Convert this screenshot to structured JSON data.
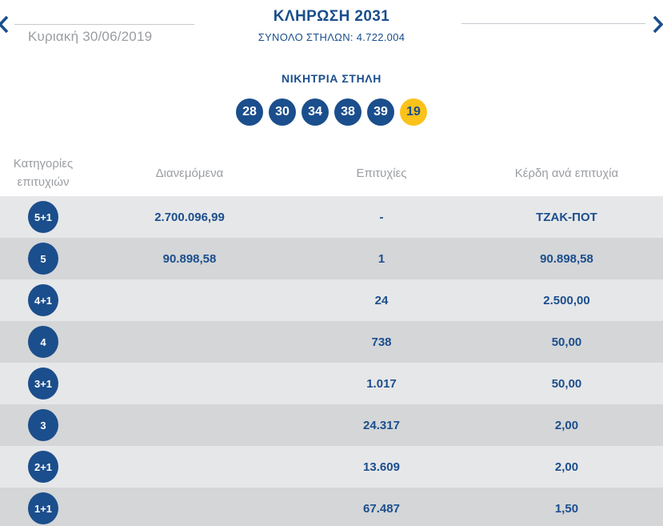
{
  "header": {
    "title": "ΚΛΗΡΩΣΗ 2031",
    "total_label": "ΣΥΝΟΛΟ ΣΤΗΛΩΝ:",
    "total_value": "4.722.004",
    "date": "Κυριακή 30/06/2019"
  },
  "winning": {
    "title": "ΝΙΚΗΤΡΙΑ ΣΤΗΛΗ",
    "numbers": [
      "28",
      "30",
      "34",
      "38",
      "39"
    ],
    "joker": "19"
  },
  "table": {
    "headers": [
      "Κατηγορίες επιτυχιών",
      "Διανεμόμενα",
      "Επιτυχίες",
      "Κέρδη ανά επιτυχία"
    ],
    "rows": [
      {
        "category": "5+1",
        "distributed": "2.700.096,99",
        "wins": "-",
        "per_win": "ΤΖΑΚ-ΠΟΤ"
      },
      {
        "category": "5",
        "distributed": "90.898,58",
        "wins": "1",
        "per_win": "90.898,58"
      },
      {
        "category": "4+1",
        "distributed": "",
        "wins": "24",
        "per_win": "2.500,00"
      },
      {
        "category": "4",
        "distributed": "",
        "wins": "738",
        "per_win": "50,00"
      },
      {
        "category": "3+1",
        "distributed": "",
        "wins": "1.017",
        "per_win": "50,00"
      },
      {
        "category": "3",
        "distributed": "",
        "wins": "24.317",
        "per_win": "2,00"
      },
      {
        "category": "2+1",
        "distributed": "",
        "wins": "13.609",
        "per_win": "2,00"
      },
      {
        "category": "1+1",
        "distributed": "",
        "wins": "67.487",
        "per_win": "1,50"
      }
    ]
  },
  "colors": {
    "blue": "#1b4e8c",
    "yellow": "#fbc21a",
    "gray_text": "#9a9da2",
    "row_light": "#e6e7e9",
    "row_dark": "#d4d6d8"
  }
}
